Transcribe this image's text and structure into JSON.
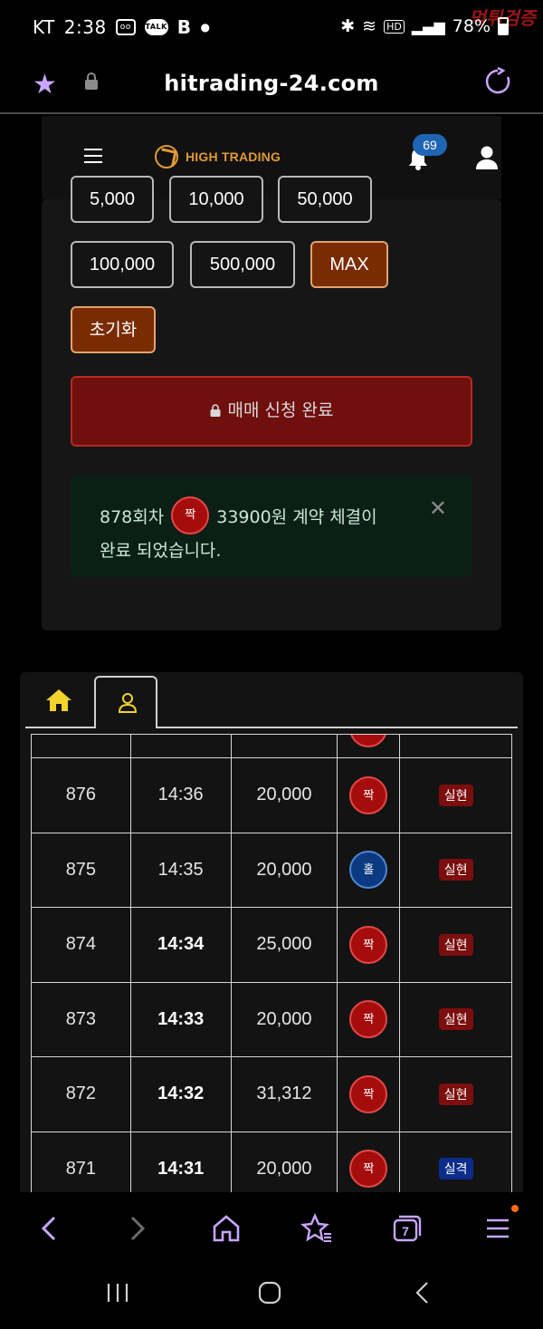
{
  "status_bar": {
    "carrier": "KT",
    "time": "2:38",
    "indicators": [
      "voicemail-icon",
      "talk-icon",
      "b-app-icon",
      "dot"
    ],
    "battery": "78%",
    "network": "HD",
    "watermark": "먹튀검증"
  },
  "browser": {
    "url": "hitrading-24.com",
    "accent_color": "#c9a6ff"
  },
  "site_header": {
    "brand": "HIGH TRADING",
    "notification_count": "69",
    "brand_color": "#e29a32"
  },
  "amount_buttons": {
    "partial": [
      "5,000",
      "10,000",
      "50,000"
    ],
    "row2": [
      "100,000",
      "500,000",
      "MAX"
    ]
  },
  "reset_label": "초기화",
  "submit_label": "매매 신청 완료",
  "alert": {
    "round": "878회차",
    "pick": "짝",
    "text_after_pick": "33900원 계약 체결이",
    "line2": "완료 되었습니다."
  },
  "history": {
    "rows": [
      {
        "round": "876",
        "time": "14:36",
        "amount": "20,000",
        "pick": "짝",
        "pick_color": "red",
        "result": "실현",
        "result_color": "red",
        "bold_time": false
      },
      {
        "round": "875",
        "time": "14:35",
        "amount": "20,000",
        "pick": "홀",
        "pick_color": "blue",
        "result": "실현",
        "result_color": "red",
        "bold_time": false
      },
      {
        "round": "874",
        "time": "14:34",
        "amount": "25,000",
        "pick": "짝",
        "pick_color": "red",
        "result": "실현",
        "result_color": "red",
        "bold_time": true
      },
      {
        "round": "873",
        "time": "14:33",
        "amount": "20,000",
        "pick": "짝",
        "pick_color": "red",
        "result": "실현",
        "result_color": "red",
        "bold_time": true
      },
      {
        "round": "872",
        "time": "14:32",
        "amount": "31,312",
        "pick": "짝",
        "pick_color": "red",
        "result": "실현",
        "result_color": "red",
        "bold_time": true
      },
      {
        "round": "871",
        "time": "14:31",
        "amount": "20,000",
        "pick": "짝",
        "pick_color": "red",
        "result": "실격",
        "result_color": "blue",
        "bold_time": true
      }
    ]
  },
  "bottom_nav": [
    "back-icon",
    "forward-icon",
    "home-icon",
    "bookmarks-icon",
    "tabs-icon",
    "menu-icon"
  ],
  "tabs_count": "7"
}
